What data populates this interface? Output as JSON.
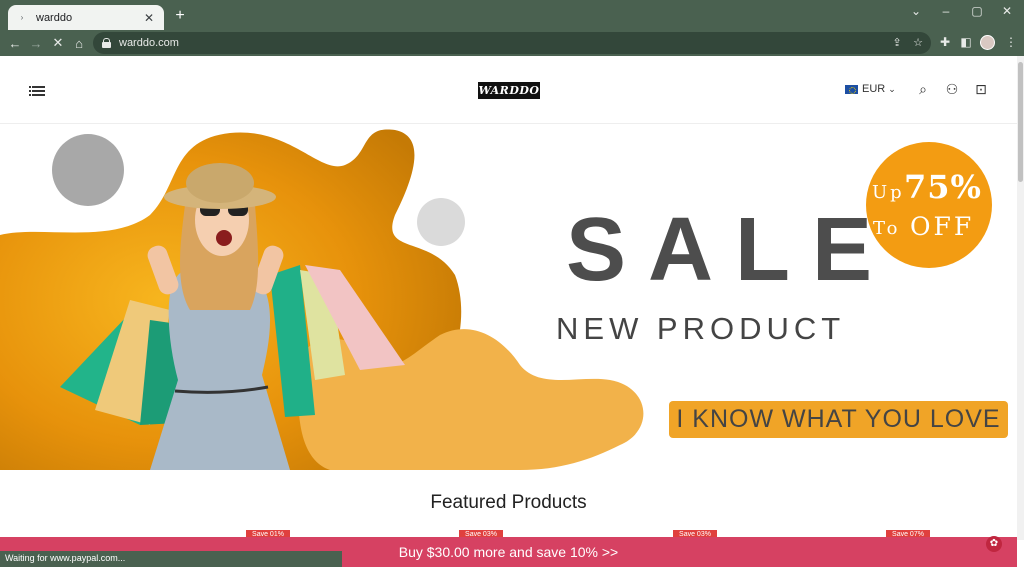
{
  "browser": {
    "tab_title": "warddo",
    "url": "warddo.com",
    "status_text": "Waiting for www.paypal.com..."
  },
  "header": {
    "logo_text": "WARDDO",
    "currency": "EUR"
  },
  "banner": {
    "headline": "SALE",
    "subheadline": "NEW PRODUCT",
    "badge_up": "Up",
    "badge_percent": "75%",
    "badge_to": "To",
    "badge_off": "OFF",
    "tagline": "I KNOW WHAT YOU LOVE"
  },
  "featured": {
    "title": "Featured Products",
    "save_tags": [
      "Save 01%",
      "Save 03%",
      "Save 03%",
      "Save 07%"
    ]
  },
  "promo_bar": {
    "text": "Buy $30.00 more and save 10%  >>"
  },
  "colors": {
    "chrome": "#4a6150",
    "accent_orange": "#f39c12",
    "promo_pink": "#d64162"
  }
}
